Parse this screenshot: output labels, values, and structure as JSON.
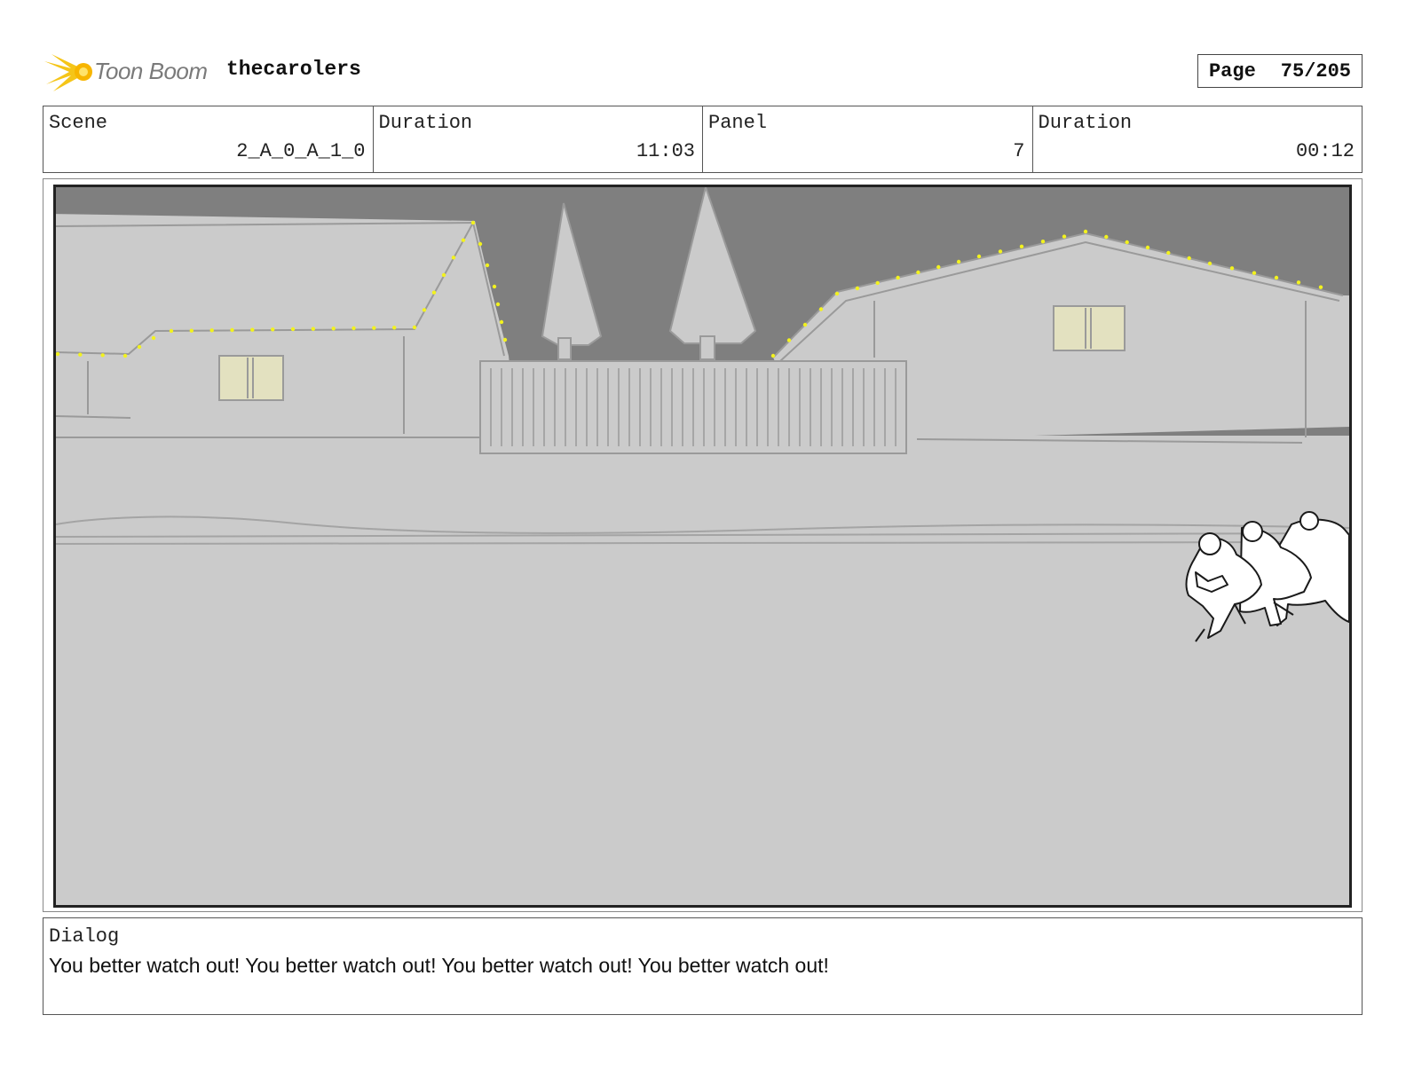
{
  "header": {
    "logo_text": "Toon Boom",
    "project_title": "thecarolers",
    "page_label": "Page",
    "page_number": "75/205"
  },
  "info": {
    "scene_label": "Scene",
    "scene_value": "2_A_0_A_1_0",
    "scene_duration_label": "Duration",
    "scene_duration_value": "11:03",
    "panel_label": "Panel",
    "panel_value": "7",
    "panel_duration_label": "Duration",
    "panel_duration_value": "00:12"
  },
  "dialog": {
    "label": "Dialog",
    "text": "You better watch out! You better watch out! You better watch out! You better watch out!"
  },
  "colors": {
    "sky": "#7f7f7f",
    "ground": "#cbcbcb",
    "lights": "#f2f21e",
    "window": "#e3e1c0",
    "logo": "#f5c518"
  },
  "panel_image": {
    "icons": [
      "houses-with-lights",
      "pine-trees",
      "fence",
      "running-carolers"
    ]
  }
}
